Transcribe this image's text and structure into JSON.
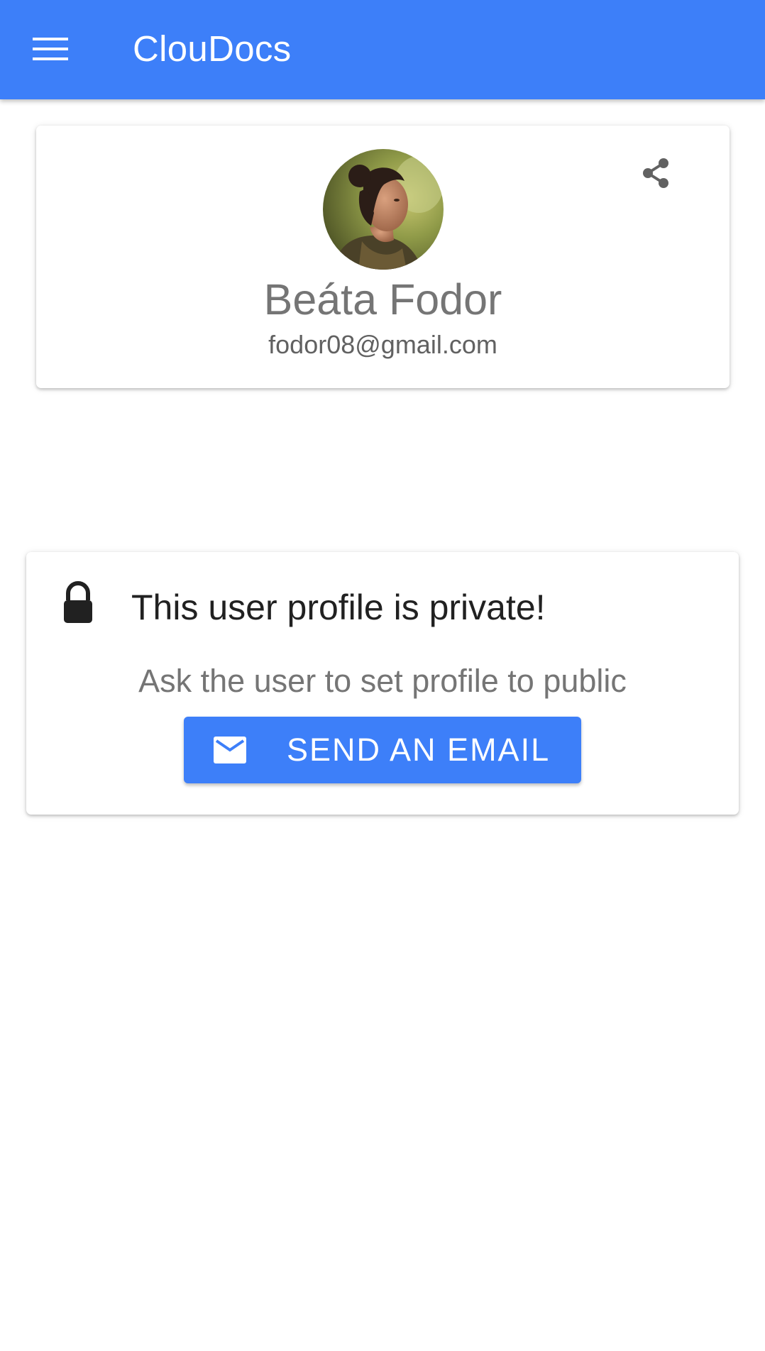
{
  "app_bar": {
    "title": "ClouDocs",
    "menu_icon": "hamburger-menu-icon",
    "background_color": "#3d7ff9"
  },
  "profile": {
    "name": "Beáta Fodor",
    "email": "fodor08@gmail.com",
    "avatar_icon": "user-avatar-photo",
    "share_icon": "share-icon"
  },
  "privacy_notice": {
    "lock_icon": "lock-icon",
    "title": "This user profile is private!",
    "subtitle": "Ask the user to set profile to public",
    "button_label": "SEND AN EMAIL",
    "button_icon": "mail-icon",
    "button_color": "#3d7ff9"
  }
}
